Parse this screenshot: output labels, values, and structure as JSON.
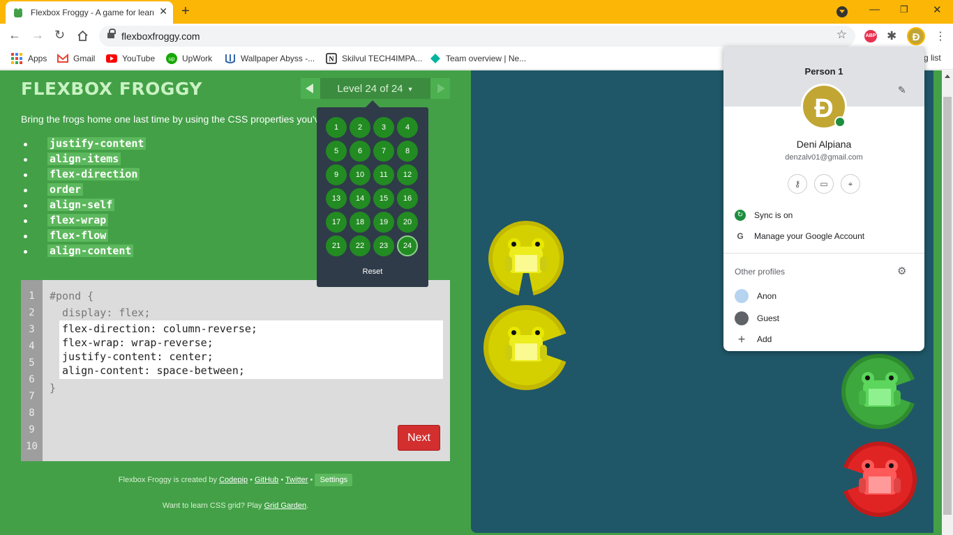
{
  "browser": {
    "tab_title": "Flexbox Froggy - A game for learning CSS flexbox",
    "url": "flexboxfroggy.com",
    "bookmarks": [
      "Apps",
      "Gmail",
      "YouTube",
      "UpWork",
      "Wallpaper Abyss -...",
      "Skilvul TECH4IMPA...",
      "Team overview | Ne..."
    ],
    "bookmark_overflow": "g list"
  },
  "game": {
    "logo": "FLEXBOX FROGGY",
    "level_label": "Level 24 of 24",
    "instructions": "Bring the frogs home one last time by using the CSS properties you've learned:",
    "properties": [
      "justify-content",
      "align-items",
      "flex-direction",
      "order",
      "align-self",
      "flex-wrap",
      "flex-flow",
      "align-content"
    ],
    "line_numbers": [
      "1",
      "2",
      "3",
      "4",
      "5",
      "6",
      "7",
      "8",
      "9",
      "10"
    ],
    "code_open": "#pond {",
    "code_display": "  display: flex;",
    "code_close": "}",
    "user_code": [
      "flex-direction: column-reverse;",
      "flex-wrap: wrap-reverse;",
      "justify-content: center;",
      "align-content: space-between;"
    ],
    "next_label": "Next",
    "footer": {
      "created_by": "Flexbox Froggy is created by",
      "codepip": "Codepip",
      "github": "GitHub",
      "twitter": "Twitter",
      "settings": "Settings",
      "learn_grid": "Want to learn CSS grid? Play",
      "grid_garden": "Grid Garden"
    },
    "levels": [
      "1",
      "2",
      "3",
      "4",
      "5",
      "6",
      "7",
      "8",
      "9",
      "10",
      "11",
      "12",
      "13",
      "14",
      "15",
      "16",
      "17",
      "18",
      "19",
      "20",
      "21",
      "22",
      "23",
      "24"
    ],
    "current_level": "24",
    "reset_label": "Reset"
  },
  "profile": {
    "title": "Person 1",
    "avatar_letter": "Ð",
    "name": "Deni Alpiana",
    "email": "denzalv01@gmail.com",
    "sync": "Sync is on",
    "manage": "Manage your Google Account",
    "other_title": "Other profiles",
    "others": [
      "Anon",
      "Guest",
      "Add"
    ]
  },
  "colors": {
    "tabbar": "#fbb606",
    "page_green": "#43a047",
    "pond": "#1f5768",
    "next": "#d32f2f",
    "doge": "#c2a633"
  }
}
